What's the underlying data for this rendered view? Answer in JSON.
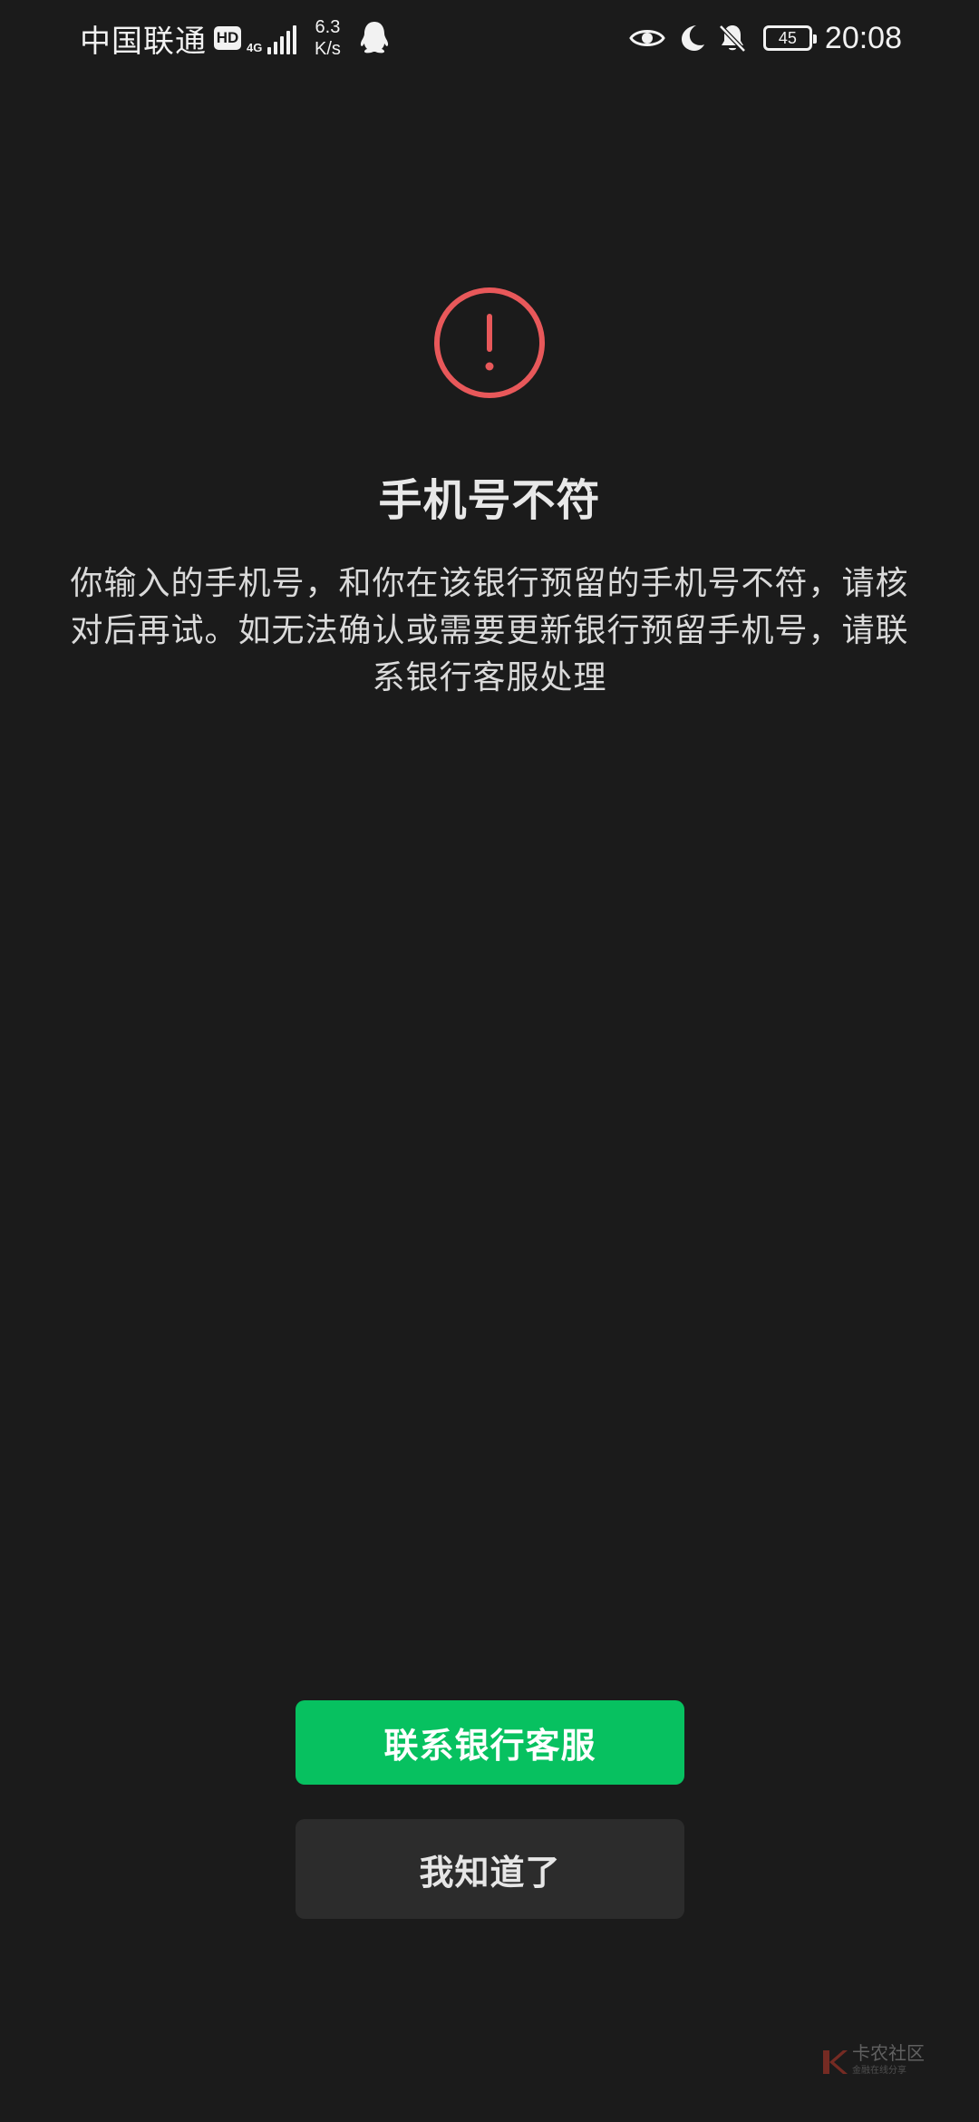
{
  "status_bar": {
    "carrier": "中国联通",
    "hd_badge": "HD",
    "network_type": "4G",
    "speed_value": "6.3",
    "speed_unit": "K/s",
    "notification_icon": "qq-penguin-icon",
    "right_icons": [
      "eye-icon",
      "moon-icon",
      "bell-off-icon"
    ],
    "battery": "45",
    "time": "20:08"
  },
  "alert": {
    "icon": "exclamation-circle-icon",
    "icon_color": "#e8585a",
    "title": "手机号不符",
    "message": "你输入的手机号，和你在该银行预留的手机号不符，请核对后再试。如无法确认或需要更新银行预留手机号，请联系银行客服处理"
  },
  "actions": {
    "contact_bank_label": "联系银行客服",
    "acknowledge_label": "我知道了",
    "primary_color": "#07c160"
  },
  "watermark": {
    "text": "卡农社区",
    "subtext": "金融在线分享"
  }
}
